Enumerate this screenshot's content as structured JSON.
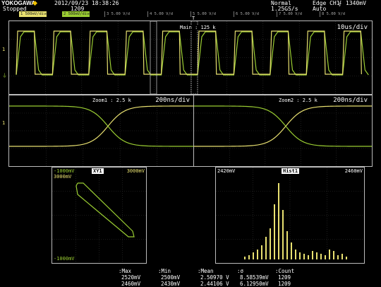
{
  "brand": "YOKOGAWA",
  "status": "Stopped",
  "datetime": "2012/09/23 18:38:26",
  "acq_count": "1209",
  "acq_mode": "Normal",
  "sample_rate": "1.25GS/s",
  "trigger_line1": "Edge CH1",
  "trigger_level": "1340mV",
  "trigger_mode": "Auto",
  "channels": [
    {
      "label": "1  500mV/div≡",
      "style": "ch1"
    },
    {
      "label": "2  500mV/div≡",
      "style": "ch2"
    },
    {
      "label": "3  5.00 V/div≡",
      "style": "off"
    },
    {
      "label": "4  5.00 V/div≡",
      "style": "off"
    },
    {
      "label": "5  5.00 V/div≡",
      "style": "off"
    },
    {
      "label": "6  5.00 V/div≡",
      "style": "off"
    },
    {
      "label": "7  5.00 V/div≡",
      "style": "off"
    },
    {
      "label": "8  5.00 V/div≡",
      "style": "off"
    }
  ],
  "main": {
    "label": "Main : 125 k",
    "timebase": "10us/div"
  },
  "zoom1": {
    "label": "Zoom1 : 2.5 k",
    "timebase": "200ns/div"
  },
  "zoom2": {
    "label": "Zoom2 : 2.5 k",
    "timebase": "200ns/div"
  },
  "xy": {
    "title": "XY1",
    "top_left": "-1000mV",
    "top_right": "3000mV",
    "y_top": "3000mV",
    "bottom_left": "-1000mV"
  },
  "hist": {
    "title": "Hist1",
    "left": "2420mV",
    "right": "2460mV"
  },
  "stats": {
    "headers": [
      ":Max",
      ":Min",
      ":Mean",
      ":σ",
      ":Count"
    ],
    "row1": [
      "2520mV",
      "2500mV",
      "2.50970 V",
      "8.58539mV",
      "1209"
    ],
    "row2": [
      "2460mV",
      "2430mV",
      "2.44106 V",
      "6.12950mV",
      "1209"
    ]
  },
  "colors": {
    "ch1": "#e8e070",
    "ch2": "#9acd32",
    "grid": "#3a3a3a"
  }
}
